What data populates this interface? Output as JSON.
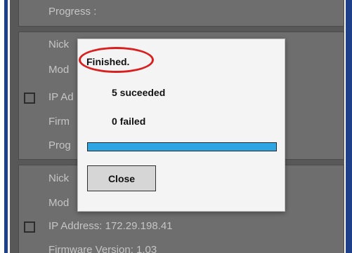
{
  "device_list": {
    "card1": {
      "progress_label": "Progress :"
    },
    "card2": {
      "nickname_label": "Nick",
      "model_label": "Mod",
      "ip_label": "IP Ad",
      "firmware_label": "Firm",
      "progress_label": "Prog"
    },
    "card3": {
      "nickname_label": "Nick",
      "model_label": "Mod",
      "ip_label": "IP Address: 172.29.198.41",
      "firmware_label": "Firmware Version: 1.03"
    }
  },
  "dialog": {
    "title": "Finished.",
    "succeeded": "5 suceeded",
    "failed": "0 failed",
    "progress_percent": 100,
    "close_label": "Close"
  },
  "colors": {
    "progress_bar": "#2ea6e3",
    "highlight_ring": "#d9201f",
    "window_frame": "#1e3f8a"
  }
}
